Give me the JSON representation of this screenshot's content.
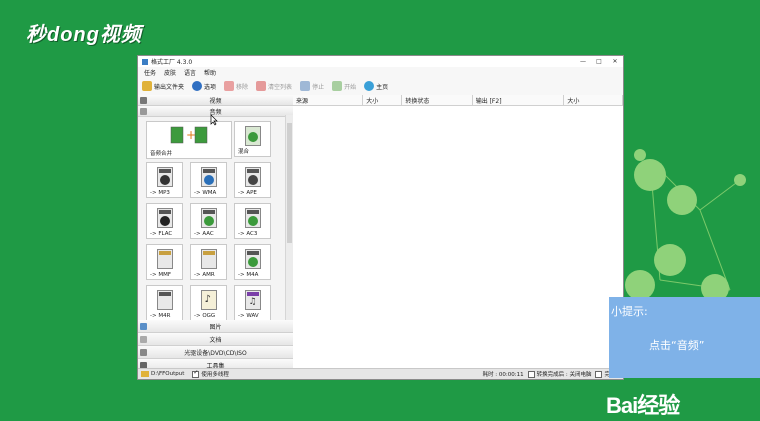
{
  "brand_top": "秒dong视频",
  "window": {
    "title": "格式工厂 4.3.0",
    "controls": [
      "—",
      "□",
      "✕"
    ]
  },
  "menu": [
    "任务",
    "皮肤",
    "语言",
    "帮助"
  ],
  "toolbar": {
    "output_folder": "输出文件夹",
    "options": "选项",
    "remove": "移除",
    "clear_list": "清空列表",
    "stop": "停止",
    "start": "开始",
    "home": "主页"
  },
  "categories_top": {
    "video": "视频",
    "audio": "音频"
  },
  "audio_tiles": {
    "merge": "音频合并",
    "mix": "混合",
    "mp3": "-> MP3",
    "wma": "-> WMA",
    "ape": "-> APE",
    "flac": "-> FLAC",
    "aac": "-> AAC",
    "ac3": "-> AC3",
    "mmf": "-> MMF",
    "amr": "-> AMR",
    "m4a": "-> M4A",
    "m4r": "-> M4R",
    "ogg": "-> OGG",
    "wav": "-> WAV"
  },
  "categories_bottom": {
    "picture": "图片",
    "document": "文档",
    "optical": "光驱设备\\DVD\\CD\\ISO",
    "tools": "工具集"
  },
  "columns": {
    "source": "来源",
    "size1": "大小",
    "status": "转换状态",
    "output": "输出 [F2]",
    "size2": "大小"
  },
  "statusbar": {
    "path": "D:\\FFOutput",
    "multithread": "使用多线程",
    "elapsed": "耗时 : 00:00:11",
    "after_convert": "转换完成后 : 关闭电脑",
    "done_notice": "完成通"
  },
  "tip": {
    "heading": "小提示:",
    "body": "点击“音频”"
  },
  "watermark": "Bai经验",
  "colors": {
    "background": "#1f9a45",
    "tip_bg": "#7fb2e8"
  }
}
